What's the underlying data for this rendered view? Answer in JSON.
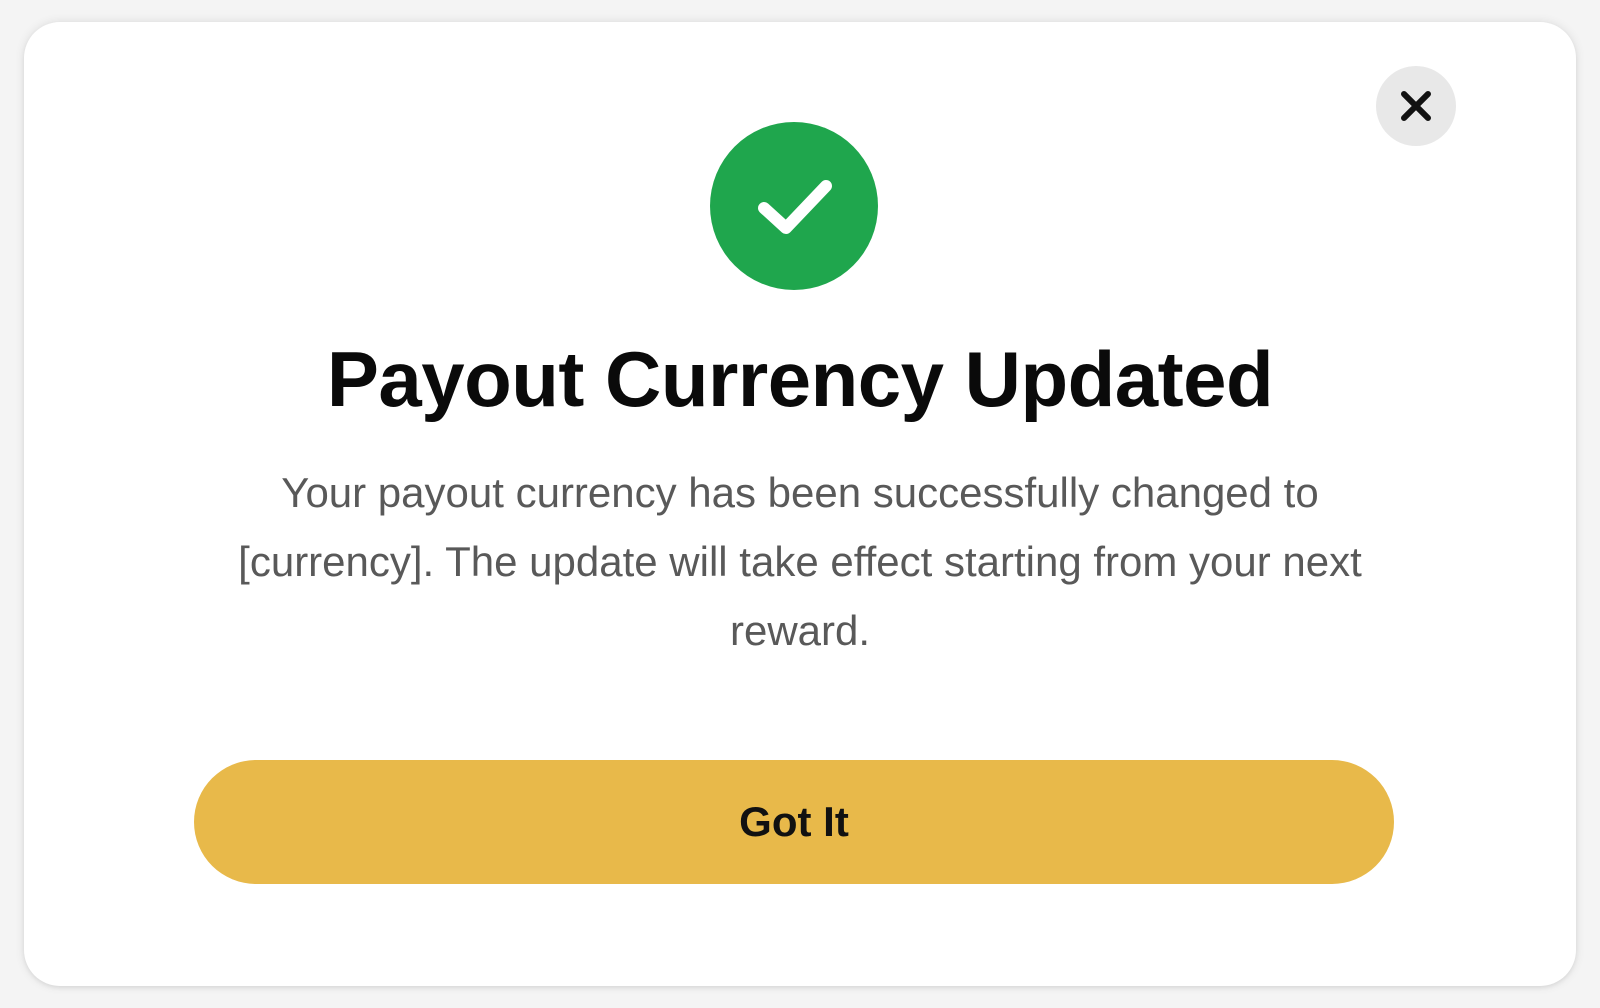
{
  "dialog": {
    "title": "Payout Currency Updated",
    "message": "Your payout currency has been successfully changed to [currency]. The update will take effect starting from your next reward.",
    "primary_button_label": "Got It",
    "close_icon": "close-icon",
    "status_icon": "check-circle-icon"
  },
  "colors": {
    "success": "#1fa64d",
    "primary_button": "#e8b94a",
    "close_button_bg": "#e8e8e8"
  }
}
